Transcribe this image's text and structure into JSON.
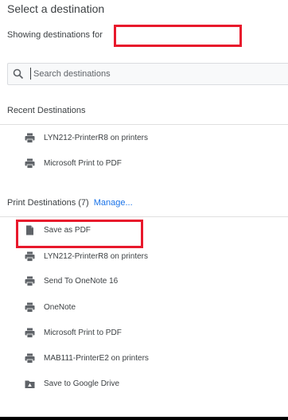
{
  "header": {
    "title": "Select a destination",
    "showing_label": "Showing destinations for"
  },
  "search": {
    "placeholder": "Search destinations"
  },
  "recent": {
    "heading": "Recent Destinations",
    "items": [
      {
        "label": "LYN212-PrinterR8 on printers",
        "icon": "printer-icon"
      },
      {
        "label": "Microsoft Print to PDF",
        "icon": "printer-icon"
      }
    ]
  },
  "print_destinations": {
    "heading": "Print Destinations (7)",
    "manage_label": "Manage...",
    "items": [
      {
        "label": "Save as PDF",
        "icon": "document-icon"
      },
      {
        "label": "LYN212-PrinterR8 on printers",
        "icon": "printer-icon"
      },
      {
        "label": "Send To OneNote 16",
        "icon": "printer-icon"
      },
      {
        "label": "OneNote",
        "icon": "printer-icon"
      },
      {
        "label": "Microsoft Print to PDF",
        "icon": "printer-icon"
      },
      {
        "label": "MAB111-PrinterE2 on printers",
        "icon": "printer-icon"
      },
      {
        "label": "Save to Google Drive",
        "icon": "google-drive-icon"
      }
    ]
  },
  "colors": {
    "accent": "#1a73e8",
    "highlight": "#e8192c",
    "icon": "#5f6368"
  }
}
